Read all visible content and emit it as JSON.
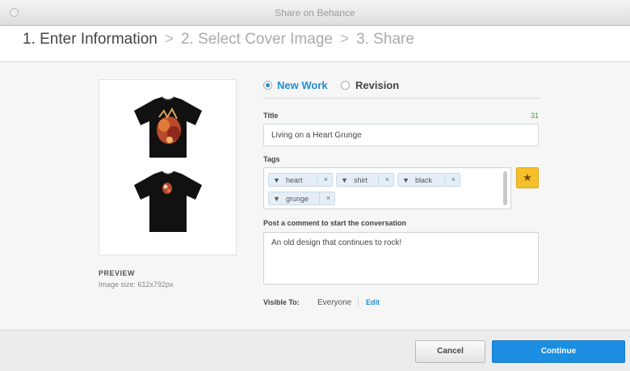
{
  "window": {
    "title": "Share on Behance"
  },
  "steps": [
    {
      "label": "1. Enter Information"
    },
    {
      "label": "2. Select Cover Image"
    },
    {
      "label": "3. Share"
    }
  ],
  "steps_separator": ">",
  "preview": {
    "label": "PREVIEW",
    "image_size": "Image size: 612x792px"
  },
  "work_type": {
    "options": [
      {
        "label": "New Work",
        "selected": true
      },
      {
        "label": "Revision",
        "selected": false
      }
    ]
  },
  "title_field": {
    "label": "Title",
    "value": "Living on a Heart Grunge",
    "remaining": "31"
  },
  "tags_field": {
    "label": "Tags",
    "tags": [
      "heart",
      "shirt",
      "black",
      "grunge"
    ],
    "remove_glyph": "×"
  },
  "comment_field": {
    "label": "Post a comment to start the conversation",
    "value": "An old design that continues to rock!"
  },
  "visibility": {
    "label": "Visible To:",
    "value": "Everyone",
    "edit_label": "Edit"
  },
  "buttons": {
    "cancel": "Cancel",
    "continue": "Continue"
  },
  "colors": {
    "accent": "#1b8ee2",
    "star": "#f5c02b",
    "count": "#3ba33b"
  }
}
